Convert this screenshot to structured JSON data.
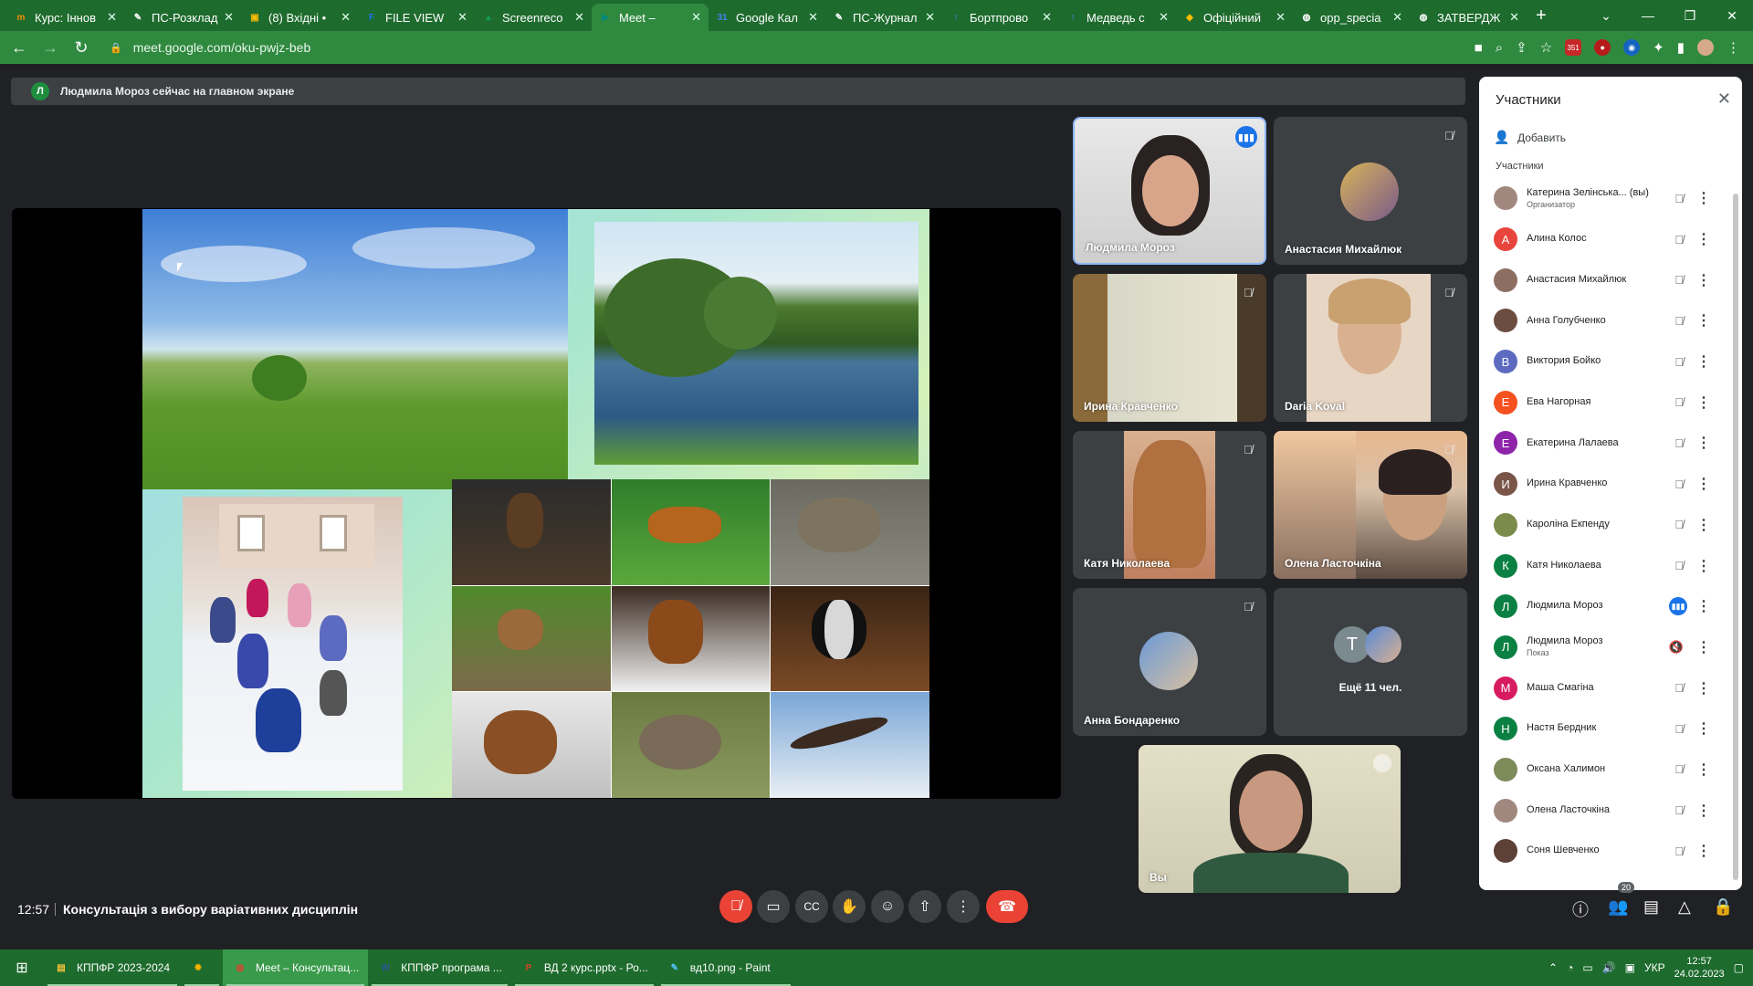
{
  "browser": {
    "tabs": [
      {
        "title": "Курс: Іннов",
        "fav": "m",
        "fav_color": "#f28c00"
      },
      {
        "title": "ПС-Розклад",
        "fav": "✎",
        "fav_color": "#ffffff"
      },
      {
        "title": "(8) Вхідні •",
        "fav": "▣",
        "fav_color": "#fbbc04"
      },
      {
        "title": "FILE VIEW",
        "fav": "F",
        "fav_color": "#1a73e8"
      },
      {
        "title": "Screenreco",
        "fav": "▲",
        "fav_color": "#0f9d58"
      },
      {
        "title": "Meet –",
        "fav": "▶",
        "fav_color": "#00897b"
      },
      {
        "title": "Google Кал",
        "fav": "31",
        "fav_color": "#4285f4"
      },
      {
        "title": "ПС-Журнал",
        "fav": "✎",
        "fav_color": "#ffffff"
      },
      {
        "title": "Бортпрово",
        "fav": "↑",
        "fav_color": "#4285f4"
      },
      {
        "title": "Медведь с",
        "fav": "↑",
        "fav_color": "#4285f4"
      },
      {
        "title": "Офіційний",
        "fav": "◆",
        "fav_color": "#fbbc04"
      },
      {
        "title": "opp_specia",
        "fav": "◍",
        "fav_color": "#ffffff"
      },
      {
        "title": "ЗАТВЕРДЖ",
        "fav": "◍",
        "fav_color": "#ffffff"
      }
    ],
    "new_tab": "+",
    "url": "meet.google.com/oku-pwjz-beb",
    "ext_badge": "351"
  },
  "banner": {
    "avatar_letter": "Л",
    "text": "Людмила Мороз сейчас на главном экране"
  },
  "tiles": [
    {
      "name": "Людмила Мороз",
      "state": "speaking"
    },
    {
      "name": "Анастасия Михайлюк",
      "state": "muted"
    },
    {
      "name": "Ирина Кравченко",
      "state": "muted"
    },
    {
      "name": "Daria Koval",
      "state": "muted"
    },
    {
      "name": "Катя Николаева",
      "state": "muted"
    },
    {
      "name": "Олена Ласточкіна",
      "state": "muted"
    },
    {
      "name": "Анна Бондаренко",
      "state": "muted"
    },
    {
      "name": "Ещё 11 чел.",
      "avatar_letter": "Т"
    },
    {
      "name": "Вы",
      "state": "muted"
    }
  ],
  "people_panel": {
    "title": "Участники",
    "add_label": "Добавить",
    "section_label": "Участники",
    "participants": [
      {
        "letter": "",
        "color": "#a1887f",
        "name": "Катерина Зелінська... (вы)",
        "sub": "Организатор",
        "mic": "muted"
      },
      {
        "letter": "А",
        "color": "#e8453c",
        "name": "Алина Колос",
        "sub": "",
        "mic": "muted"
      },
      {
        "letter": "",
        "color": "#8d6e63",
        "name": "Анастасия Михайлюк",
        "sub": "",
        "mic": "muted"
      },
      {
        "letter": "",
        "color": "#6d4c41",
        "name": "Анна Голубченко",
        "sub": "",
        "mic": "muted"
      },
      {
        "letter": "В",
        "color": "#5c6bc0",
        "name": "Виктория Бойко",
        "sub": "",
        "mic": "muted"
      },
      {
        "letter": "Е",
        "color": "#f4511e",
        "name": "Ева Нагорная",
        "sub": "",
        "mic": "muted"
      },
      {
        "letter": "Е",
        "color": "#8e24aa",
        "name": "Екатерина Лалаева",
        "sub": "",
        "mic": "muted"
      },
      {
        "letter": "И",
        "color": "#795548",
        "name": "Ирина Кравченко",
        "sub": "",
        "mic": "muted"
      },
      {
        "letter": "",
        "color": "#7b8b4a",
        "name": "Кароліна Екпенду",
        "sub": "",
        "mic": "muted"
      },
      {
        "letter": "К",
        "color": "#0b8043",
        "name": "Катя Николаева",
        "sub": "",
        "mic": "muted"
      },
      {
        "letter": "Л",
        "color": "#0b8043",
        "name": "Людмила Мороз",
        "sub": "",
        "mic": "speaking"
      },
      {
        "letter": "Л",
        "color": "#0b8043",
        "name": "Людмила Мороз",
        "sub": "Показ",
        "mic": "present"
      },
      {
        "letter": "М",
        "color": "#d81b60",
        "name": "Маша Смагіна",
        "sub": "",
        "mic": "muted"
      },
      {
        "letter": "Н",
        "color": "#0b8043",
        "name": "Настя Бердник",
        "sub": "",
        "mic": "muted"
      },
      {
        "letter": "",
        "color": "#7d8a5a",
        "name": "Оксана Халимон",
        "sub": "",
        "mic": "muted"
      },
      {
        "letter": "",
        "color": "#a1887f",
        "name": "Олена Ласточкіна",
        "sub": "",
        "mic": "muted"
      },
      {
        "letter": "",
        "color": "#5d4037",
        "name": "Соня Шевченко",
        "sub": "",
        "mic": "muted"
      }
    ]
  },
  "bottom": {
    "time": "12:57",
    "meeting_title": "Консультація з вибору варіативних дисциплін",
    "participant_count": "20"
  },
  "taskbar": {
    "items": [
      {
        "label": "КППФР 2023-2024",
        "icon": "▤",
        "color": "#f9c23c",
        "active": false
      },
      {
        "label": "",
        "icon": "✹",
        "color": "#f4b400",
        "active": false
      },
      {
        "label": "Meet – Консультац...",
        "icon": "◍",
        "color": "#db4437",
        "active": true
      },
      {
        "label": "КППФР програма ...",
        "icon": "W",
        "color": "#2b579a",
        "active": false
      },
      {
        "label": "ВД 2 курс.pptx - Ро...",
        "icon": "P",
        "color": "#d24726",
        "active": false
      },
      {
        "label": "вд10.png - Paint",
        "icon": "✎",
        "color": "#4fc3f7",
        "active": false
      }
    ],
    "lang": "УКР",
    "time": "12:57",
    "date": "24.02.2023"
  }
}
